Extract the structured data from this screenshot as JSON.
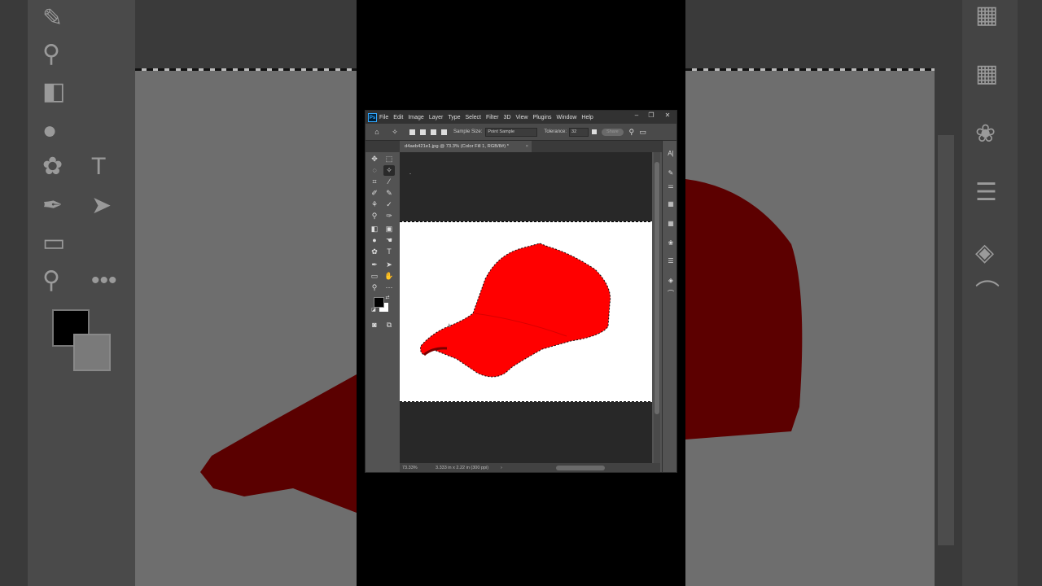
{
  "app": {
    "logo": "Ps"
  },
  "menu": [
    "File",
    "Edit",
    "Image",
    "Layer",
    "Type",
    "Select",
    "Filter",
    "3D",
    "View",
    "Plugins",
    "Window",
    "Help"
  ],
  "window_controls": {
    "minimize": "–",
    "restore": "❐",
    "close": "✕"
  },
  "options": {
    "sample_size_label": "Sample Size:",
    "sample_size_value": "Point Sample",
    "tolerance_label": "Tolerance:",
    "tolerance_value": "32",
    "share_label": "Share"
  },
  "document": {
    "tab_title": "d4aeb421e1.jpg @ 73.3% (Color Fill 1, RGB/8#) *",
    "close": "×"
  },
  "status": {
    "zoom": "73.33%",
    "doc_info": "3.333 in x 2.22 in (300 ppi)"
  },
  "colors": {
    "cap_red": "#ff0000",
    "foreground": "#000000",
    "background": "#ffffff",
    "ui_dark": "#535353"
  },
  "tools": [
    "move-icon",
    "marquee-icon",
    "lasso-icon",
    "magic-wand-icon",
    "crop-icon",
    "eyedropper-icon",
    "spot-healing-icon",
    "brush-icon",
    "clone-stamp-icon",
    "history-brush-icon",
    "eraser-icon",
    "gradient-icon",
    "blur-icon",
    "smudge-icon",
    "dodge-icon",
    "type-icon",
    "pen-icon",
    "path-select-icon",
    "rectangle-icon",
    "hand-icon",
    "zoom-icon",
    "more-icon"
  ],
  "panel_icons": [
    "character-icon",
    "brush-settings-icon",
    "properties-icon",
    "grid-icon",
    "table-icon",
    "channels-icon",
    "adjustments-icon",
    "layers-icon",
    "paths-icon"
  ]
}
